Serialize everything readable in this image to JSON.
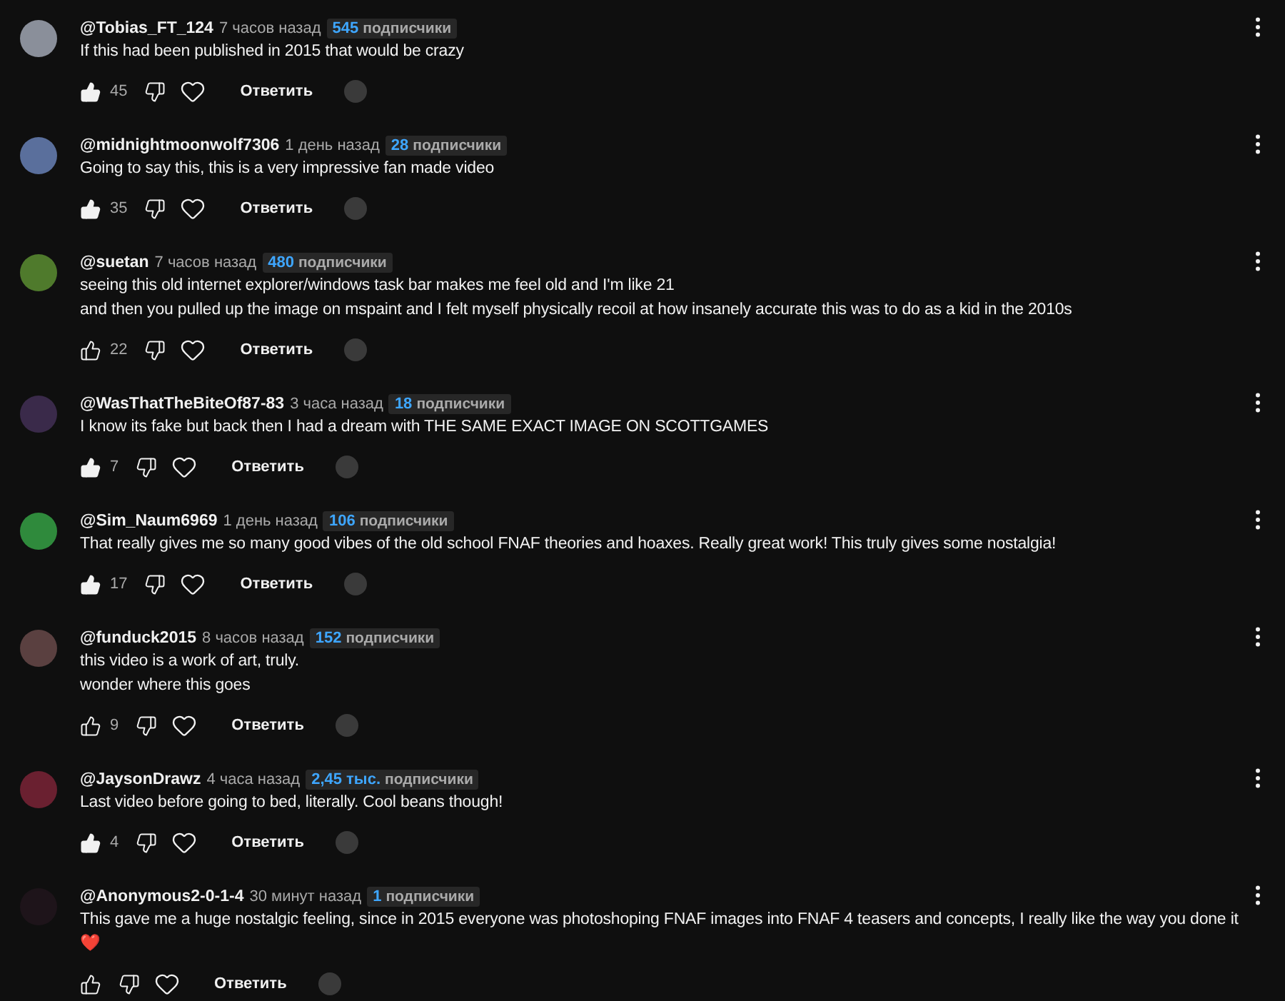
{
  "comments": [
    {
      "author": "@Tobias_FT_124",
      "time": "7 часов назад",
      "subscribers": "545",
      "subscribers_label": "подписчики",
      "color": "#8a8f9a",
      "lines": [
        "If this had been published in 2015 that would be crazy"
      ],
      "liked": true,
      "likes": "45",
      "reply": "Ответить"
    },
    {
      "author": "@midnightmoonwolf7306",
      "time": "1 день назад",
      "subscribers": "28",
      "subscribers_label": "подписчики",
      "color": "#5a6f9c",
      "lines": [
        "Going to say this, this is a very impressive fan made video"
      ],
      "liked": true,
      "likes": "35",
      "reply": "Ответить"
    },
    {
      "author": "@suetan",
      "time": "7 часов назад",
      "subscribers": "480",
      "subscribers_label": "подписчики",
      "color": "#4f7a2c",
      "lines": [
        "seeing this old internet explorer/windows task bar makes me feel old and I'm like 21",
        "and then you pulled up the image on mspaint and I felt myself physically recoil at how insanely accurate this was to do as a kid in the 2010s"
      ],
      "liked": false,
      "likes": "22",
      "reply": "Ответить"
    },
    {
      "author": "@WasThatTheBiteOf87-83",
      "time": "3 часа назад",
      "subscribers": "18",
      "subscribers_label": "подписчики",
      "color": "#3a2a4a",
      "lines": [
        "I know its fake but back then I had a dream with THE SAME EXACT IMAGE ON SCOTTGAMES"
      ],
      "liked": true,
      "likes": "7",
      "reply": "Ответить"
    },
    {
      "author": "@Sim_Naum6969",
      "time": "1 день назад",
      "subscribers": "106",
      "subscribers_label": "подписчики",
      "color": "#2f8a3c",
      "lines": [
        "That really gives me so many good vibes of the old school FNAF theories and hoaxes. Really great work! This truly gives some nostalgia!"
      ],
      "liked": true,
      "likes": "17",
      "reply": "Ответить"
    },
    {
      "author": "@funduck2015",
      "time": "8 часов назад",
      "subscribers": "152",
      "subscribers_label": "подписчики",
      "color": "#5a4040",
      "lines": [
        "this video is a work of art, truly.",
        "wonder where this goes"
      ],
      "liked": false,
      "likes": "9",
      "reply": "Ответить"
    },
    {
      "author": "@JaysonDrawz",
      "time": "4 часа назад",
      "subscribers": "2,45 тыс.",
      "subscribers_label": "подписчики",
      "color": "#6a2030",
      "lines": [
        "Last video before going to bed, literally. Cool beans though!"
      ],
      "liked": true,
      "likes": "4",
      "reply": "Ответить"
    },
    {
      "author": "@Anonymous2-0-1-4",
      "time": "30 минут назад",
      "subscribers": "1",
      "subscribers_label": "подписчики",
      "color": "#1e141a",
      "lines": [
        "This gave me a huge nostalgic feeling, since in 2015 everyone was photoshoping FNAF images into FNAF 4 teasers and concepts, I really like the way you done it",
        "❤️"
      ],
      "liked": false,
      "reply": "Ответить"
    }
  ]
}
